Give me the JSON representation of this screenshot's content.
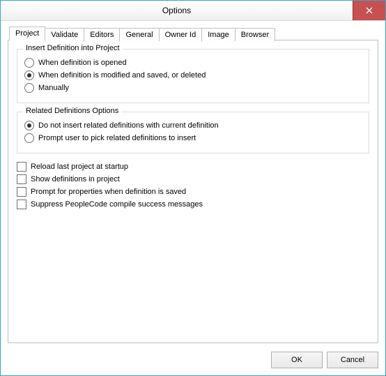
{
  "window": {
    "title": "Options"
  },
  "tabs": [
    {
      "label": "Project",
      "active": true
    },
    {
      "label": "Validate",
      "active": false
    },
    {
      "label": "Editors",
      "active": false
    },
    {
      "label": "General",
      "active": false
    },
    {
      "label": "Owner Id",
      "active": false
    },
    {
      "label": "Image",
      "active": false
    },
    {
      "label": "Browser",
      "active": false
    }
  ],
  "group1": {
    "legend": "Insert Definition into Project",
    "options": [
      {
        "label": "When definition is opened",
        "selected": false
      },
      {
        "label": "When definition is modified and saved, or deleted",
        "selected": true
      },
      {
        "label": "Manually",
        "selected": false
      }
    ]
  },
  "group2": {
    "legend": "Related Definitions Options",
    "options": [
      {
        "label": "Do not insert related definitions with current definition",
        "selected": true
      },
      {
        "label": "Prompt user to pick related definitions to insert",
        "selected": false
      }
    ]
  },
  "checks": [
    {
      "label": "Reload last project at startup",
      "checked": false
    },
    {
      "label": "Show definitions in project",
      "checked": false
    },
    {
      "label": "Prompt for properties when definition is saved",
      "checked": false
    },
    {
      "label": "Suppress PeopleCode compile success messages",
      "checked": false
    }
  ],
  "buttons": {
    "ok": "OK",
    "cancel": "Cancel"
  }
}
